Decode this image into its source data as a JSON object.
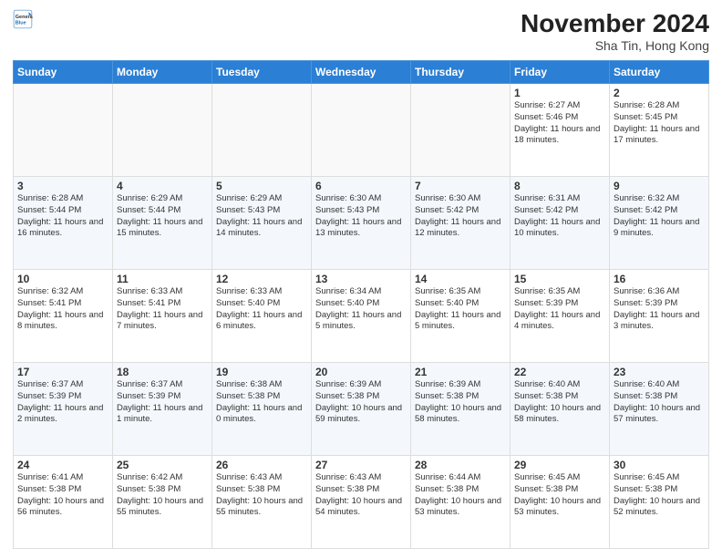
{
  "header": {
    "title": "November 2024",
    "subtitle": "Sha Tin, Hong Kong",
    "logo_line1": "General",
    "logo_line2": "Blue"
  },
  "weekdays": [
    "Sunday",
    "Monday",
    "Tuesday",
    "Wednesday",
    "Thursday",
    "Friday",
    "Saturday"
  ],
  "weeks": [
    [
      {
        "day": "",
        "info": ""
      },
      {
        "day": "",
        "info": ""
      },
      {
        "day": "",
        "info": ""
      },
      {
        "day": "",
        "info": ""
      },
      {
        "day": "",
        "info": ""
      },
      {
        "day": "1",
        "info": "Sunrise: 6:27 AM\nSunset: 5:46 PM\nDaylight: 11 hours and 18 minutes."
      },
      {
        "day": "2",
        "info": "Sunrise: 6:28 AM\nSunset: 5:45 PM\nDaylight: 11 hours and 17 minutes."
      }
    ],
    [
      {
        "day": "3",
        "info": "Sunrise: 6:28 AM\nSunset: 5:44 PM\nDaylight: 11 hours and 16 minutes."
      },
      {
        "day": "4",
        "info": "Sunrise: 6:29 AM\nSunset: 5:44 PM\nDaylight: 11 hours and 15 minutes."
      },
      {
        "day": "5",
        "info": "Sunrise: 6:29 AM\nSunset: 5:43 PM\nDaylight: 11 hours and 14 minutes."
      },
      {
        "day": "6",
        "info": "Sunrise: 6:30 AM\nSunset: 5:43 PM\nDaylight: 11 hours and 13 minutes."
      },
      {
        "day": "7",
        "info": "Sunrise: 6:30 AM\nSunset: 5:42 PM\nDaylight: 11 hours and 12 minutes."
      },
      {
        "day": "8",
        "info": "Sunrise: 6:31 AM\nSunset: 5:42 PM\nDaylight: 11 hours and 10 minutes."
      },
      {
        "day": "9",
        "info": "Sunrise: 6:32 AM\nSunset: 5:42 PM\nDaylight: 11 hours and 9 minutes."
      }
    ],
    [
      {
        "day": "10",
        "info": "Sunrise: 6:32 AM\nSunset: 5:41 PM\nDaylight: 11 hours and 8 minutes."
      },
      {
        "day": "11",
        "info": "Sunrise: 6:33 AM\nSunset: 5:41 PM\nDaylight: 11 hours and 7 minutes."
      },
      {
        "day": "12",
        "info": "Sunrise: 6:33 AM\nSunset: 5:40 PM\nDaylight: 11 hours and 6 minutes."
      },
      {
        "day": "13",
        "info": "Sunrise: 6:34 AM\nSunset: 5:40 PM\nDaylight: 11 hours and 5 minutes."
      },
      {
        "day": "14",
        "info": "Sunrise: 6:35 AM\nSunset: 5:40 PM\nDaylight: 11 hours and 5 minutes."
      },
      {
        "day": "15",
        "info": "Sunrise: 6:35 AM\nSunset: 5:39 PM\nDaylight: 11 hours and 4 minutes."
      },
      {
        "day": "16",
        "info": "Sunrise: 6:36 AM\nSunset: 5:39 PM\nDaylight: 11 hours and 3 minutes."
      }
    ],
    [
      {
        "day": "17",
        "info": "Sunrise: 6:37 AM\nSunset: 5:39 PM\nDaylight: 11 hours and 2 minutes."
      },
      {
        "day": "18",
        "info": "Sunrise: 6:37 AM\nSunset: 5:39 PM\nDaylight: 11 hours and 1 minute."
      },
      {
        "day": "19",
        "info": "Sunrise: 6:38 AM\nSunset: 5:38 PM\nDaylight: 11 hours and 0 minutes."
      },
      {
        "day": "20",
        "info": "Sunrise: 6:39 AM\nSunset: 5:38 PM\nDaylight: 10 hours and 59 minutes."
      },
      {
        "day": "21",
        "info": "Sunrise: 6:39 AM\nSunset: 5:38 PM\nDaylight: 10 hours and 58 minutes."
      },
      {
        "day": "22",
        "info": "Sunrise: 6:40 AM\nSunset: 5:38 PM\nDaylight: 10 hours and 58 minutes."
      },
      {
        "day": "23",
        "info": "Sunrise: 6:40 AM\nSunset: 5:38 PM\nDaylight: 10 hours and 57 minutes."
      }
    ],
    [
      {
        "day": "24",
        "info": "Sunrise: 6:41 AM\nSunset: 5:38 PM\nDaylight: 10 hours and 56 minutes."
      },
      {
        "day": "25",
        "info": "Sunrise: 6:42 AM\nSunset: 5:38 PM\nDaylight: 10 hours and 55 minutes."
      },
      {
        "day": "26",
        "info": "Sunrise: 6:43 AM\nSunset: 5:38 PM\nDaylight: 10 hours and 55 minutes."
      },
      {
        "day": "27",
        "info": "Sunrise: 6:43 AM\nSunset: 5:38 PM\nDaylight: 10 hours and 54 minutes."
      },
      {
        "day": "28",
        "info": "Sunrise: 6:44 AM\nSunset: 5:38 PM\nDaylight: 10 hours and 53 minutes."
      },
      {
        "day": "29",
        "info": "Sunrise: 6:45 AM\nSunset: 5:38 PM\nDaylight: 10 hours and 53 minutes."
      },
      {
        "day": "30",
        "info": "Sunrise: 6:45 AM\nSunset: 5:38 PM\nDaylight: 10 hours and 52 minutes."
      }
    ]
  ]
}
